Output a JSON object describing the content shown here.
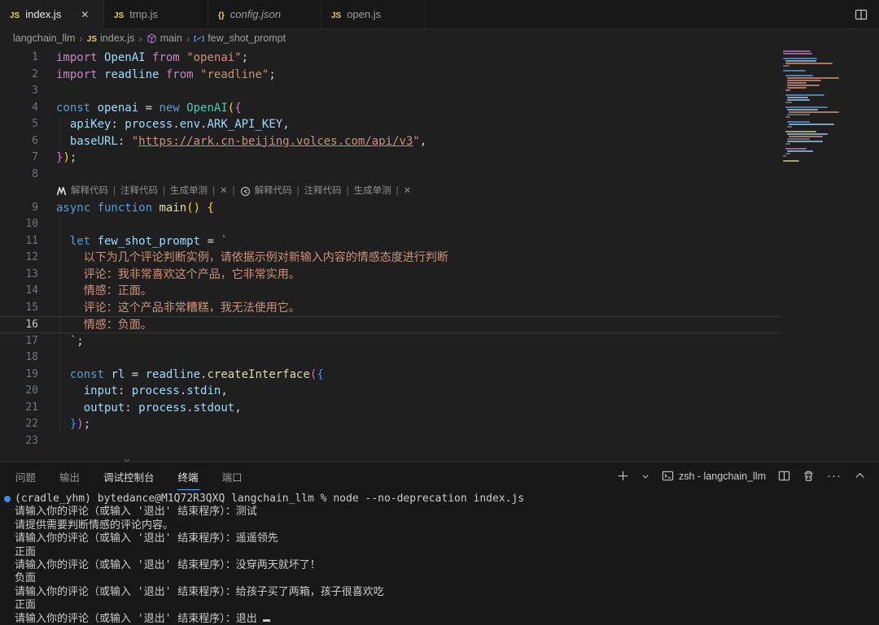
{
  "colors": {
    "accent": "#4daafc",
    "terminal_badge": "#3b8eea",
    "js_icon": "#e8d44d",
    "token": {
      "pk": "#c586c0",
      "bk": "#569cd6",
      "id": "#9cdcfe",
      "cls": "#4ec9b0",
      "fn": "#dcdcaa",
      "str": "#ce9178",
      "b1": "#ffd700",
      "b2": "#da70d6",
      "b3": "#179fff"
    }
  },
  "tabbar": {
    "tabs": [
      {
        "label": "index.js",
        "icon": "js",
        "active": true,
        "closable": true
      },
      {
        "label": "tmp.js",
        "icon": "js"
      },
      {
        "label": "config.json",
        "icon": "braces",
        "preview": true
      },
      {
        "label": "open.js",
        "icon": "js"
      }
    ],
    "actions": [
      {
        "name": "split-editor",
        "icon": "split"
      }
    ]
  },
  "breadcrumb": {
    "items": [
      {
        "label": "langchain_llm"
      },
      {
        "label": "index.js",
        "icon": "js"
      },
      {
        "label": "main",
        "icon": "cube"
      },
      {
        "label": "few_shot_prompt",
        "icon": "variable"
      }
    ]
  },
  "editor": {
    "codelens": {
      "after_line": 8,
      "groups": [
        {
          "icon": "marscode",
          "items": [
            "解释代码",
            "注释代码",
            "生成单测",
            "✕"
          ]
        },
        {
          "icon": "ai-circle",
          "items": [
            "解释代码",
            "注释代码",
            "生成单测",
            "✕"
          ]
        }
      ]
    },
    "current_line": 16,
    "lines": [
      {
        "n": 1,
        "segs": [
          [
            "pk",
            "import "
          ],
          [
            "id",
            "OpenAI"
          ],
          [
            "pk",
            " from "
          ],
          [
            "str",
            "\"openai\""
          ],
          [
            "pn",
            ";"
          ]
        ]
      },
      {
        "n": 2,
        "segs": [
          [
            "pk",
            "import "
          ],
          [
            "id",
            "readline"
          ],
          [
            "pk",
            " from "
          ],
          [
            "str",
            "\"readline\""
          ],
          [
            "pn",
            ";"
          ]
        ]
      },
      {
        "n": 3,
        "segs": []
      },
      {
        "n": 4,
        "segs": [
          [
            "bk",
            "const "
          ],
          [
            "id",
            "openai"
          ],
          [
            "pn",
            " = "
          ],
          [
            "bk",
            "new "
          ],
          [
            "cls",
            "OpenAI"
          ],
          [
            "b1",
            "("
          ],
          [
            "b2",
            "{"
          ]
        ]
      },
      {
        "n": 5,
        "guide": true,
        "segs": [
          [
            "pn",
            "  "
          ],
          [
            "id",
            "apiKey"
          ],
          [
            "pn",
            ": "
          ],
          [
            "id",
            "process"
          ],
          [
            "pn",
            "."
          ],
          [
            "id",
            "env"
          ],
          [
            "pn",
            "."
          ],
          [
            "id",
            "ARK_API_KEY"
          ],
          [
            "pn",
            ","
          ]
        ]
      },
      {
        "n": 6,
        "guide": true,
        "segs": [
          [
            "pn",
            "  "
          ],
          [
            "id",
            "baseURL"
          ],
          [
            "pn",
            ": "
          ],
          [
            "str",
            "\""
          ],
          [
            "lnk",
            "https://ark.cn-beijing.volces.com/api/v3"
          ],
          [
            "str",
            "\""
          ],
          [
            "pn",
            ","
          ]
        ]
      },
      {
        "n": 7,
        "segs": [
          [
            "b2",
            "}"
          ],
          [
            "b1",
            ")"
          ],
          [
            "pn",
            ";"
          ]
        ]
      },
      {
        "n": 8,
        "segs": []
      },
      {
        "n": 9,
        "segs": [
          [
            "bk",
            "async "
          ],
          [
            "bk",
            "function "
          ],
          [
            "fn",
            "main"
          ],
          [
            "b1",
            "()"
          ],
          [
            "pn",
            " "
          ],
          [
            "b1",
            "{"
          ]
        ]
      },
      {
        "n": 10,
        "guide": true,
        "segs": []
      },
      {
        "n": 11,
        "guide": true,
        "segs": [
          [
            "pn",
            "  "
          ],
          [
            "bk",
            "let "
          ],
          [
            "id",
            "few_shot_prompt"
          ],
          [
            "pn",
            " = "
          ],
          [
            "str",
            "`"
          ]
        ]
      },
      {
        "n": 12,
        "guide": true,
        "segs": [
          [
            "str",
            "    以下为几个评论判断实例，请依据示例对新输入内容的情感态度进行判断"
          ]
        ]
      },
      {
        "n": 13,
        "guide": true,
        "segs": [
          [
            "str",
            "    评论：我非常喜欢这个产品，它非常实用。"
          ]
        ]
      },
      {
        "n": 14,
        "guide": true,
        "segs": [
          [
            "str",
            "    情感：正面。"
          ]
        ]
      },
      {
        "n": 15,
        "guide": true,
        "segs": [
          [
            "str",
            "    评论：这个产品非常糟糕，我无法使用它。"
          ]
        ]
      },
      {
        "n": 16,
        "guide": true,
        "segs": [
          [
            "str",
            "    情感：负面。"
          ]
        ]
      },
      {
        "n": 17,
        "guide": true,
        "segs": [
          [
            "str",
            "  `"
          ],
          [
            "pn",
            ";"
          ]
        ]
      },
      {
        "n": 18,
        "guide": true,
        "segs": []
      },
      {
        "n": 19,
        "guide": true,
        "segs": [
          [
            "pn",
            "  "
          ],
          [
            "bk",
            "const "
          ],
          [
            "id",
            "rl"
          ],
          [
            "pn",
            " = "
          ],
          [
            "id",
            "readline"
          ],
          [
            "pn",
            "."
          ],
          [
            "fn",
            "createInterface"
          ],
          [
            "b2",
            "("
          ],
          [
            "b3",
            "{"
          ]
        ]
      },
      {
        "n": 20,
        "guide": true,
        "segs": [
          [
            "pn",
            "    "
          ],
          [
            "id",
            "input"
          ],
          [
            "pn",
            ": "
          ],
          [
            "id",
            "process"
          ],
          [
            "pn",
            "."
          ],
          [
            "id",
            "stdin"
          ],
          [
            "pn",
            ","
          ]
        ]
      },
      {
        "n": 21,
        "guide": true,
        "segs": [
          [
            "pn",
            "    "
          ],
          [
            "id",
            "output"
          ],
          [
            "pn",
            ": "
          ],
          [
            "id",
            "process"
          ],
          [
            "pn",
            "."
          ],
          [
            "id",
            "stdout"
          ],
          [
            "pn",
            ","
          ]
        ]
      },
      {
        "n": 22,
        "guide": true,
        "segs": [
          [
            "pn",
            "  "
          ],
          [
            "b3",
            "}"
          ],
          [
            "b2",
            ")"
          ],
          [
            "pn",
            ";"
          ]
        ]
      },
      {
        "n": 23,
        "segs": []
      }
    ],
    "overflow_hint": "⌄"
  },
  "minimap": {
    "rows": [
      [
        0,
        34,
        "p"
      ],
      [
        0,
        36,
        "p"
      ],
      [
        0,
        0,
        "n"
      ],
      [
        0,
        42,
        "b"
      ],
      [
        3,
        38,
        "i"
      ],
      [
        3,
        58,
        "o"
      ],
      [
        0,
        8,
        "g"
      ],
      [
        0,
        0,
        "n"
      ],
      [
        0,
        28,
        "b"
      ],
      [
        0,
        0,
        "n"
      ],
      [
        3,
        34,
        "b"
      ],
      [
        5,
        64,
        "o"
      ],
      [
        5,
        42,
        "o"
      ],
      [
        5,
        24,
        "o"
      ],
      [
        5,
        40,
        "o"
      ],
      [
        5,
        24,
        "o"
      ],
      [
        3,
        6,
        "o"
      ],
      [
        0,
        0,
        "n"
      ],
      [
        3,
        48,
        "b"
      ],
      [
        5,
        26,
        "i"
      ],
      [
        5,
        28,
        "i"
      ],
      [
        3,
        8,
        "g"
      ],
      [
        0,
        0,
        "n"
      ],
      [
        3,
        52,
        "b"
      ],
      [
        5,
        38,
        "i"
      ],
      [
        7,
        62,
        "o"
      ],
      [
        5,
        28,
        "g"
      ],
      [
        3,
        6,
        "g"
      ],
      [
        0,
        0,
        "n"
      ],
      [
        5,
        28,
        "b"
      ],
      [
        7,
        56,
        "i"
      ],
      [
        5,
        6,
        "g"
      ],
      [
        0,
        0,
        "n"
      ],
      [
        3,
        38,
        "y"
      ],
      [
        5,
        50,
        "i"
      ],
      [
        7,
        42,
        "o"
      ],
      [
        5,
        28,
        "g"
      ],
      [
        5,
        44,
        "i"
      ],
      [
        3,
        6,
        "g"
      ],
      [
        0,
        0,
        "n"
      ],
      [
        3,
        26,
        "p"
      ],
      [
        5,
        32,
        "i"
      ],
      [
        3,
        6,
        "g"
      ],
      [
        0,
        4,
        "g"
      ],
      [
        0,
        0,
        "n"
      ],
      [
        0,
        20,
        "y"
      ]
    ],
    "palette": {
      "p": "#9a5ca3",
      "b": "#4d7da8",
      "i": "#7fa3bd",
      "o": "#a8796a",
      "y": "#a8a06a",
      "g": "#6a6a6a",
      "n": "transparent"
    }
  },
  "panel": {
    "tabs": [
      {
        "label": "问题"
      },
      {
        "label": "输出"
      },
      {
        "label": "调试控制台",
        "bright": true
      },
      {
        "label": "终端",
        "active": true
      },
      {
        "label": "端口"
      }
    ],
    "terminal_label": "zsh - langchain_llm",
    "actions_left": [
      {
        "name": "new-terminal",
        "icon": "plus"
      },
      {
        "name": "launch-profile",
        "icon": "chevron-down"
      }
    ],
    "actions_right": [
      {
        "name": "split-terminal",
        "icon": "split"
      },
      {
        "name": "kill-terminal",
        "icon": "trash"
      },
      {
        "name": "more-actions",
        "icon": "ellipsis"
      },
      {
        "name": "maximize-panel",
        "icon": "chevron-up"
      }
    ]
  },
  "terminal": {
    "lines": [
      {
        "text": "(cradle_yhm) bytedance@M1Q72R3QXQ langchain_llm % node --no-deprecation index.js",
        "badge": true
      },
      {
        "text": "请输入你的评论（或输入 '退出' 结束程序）：测试"
      },
      {
        "text": "请提供需要判断情感的评论内容。"
      },
      {
        "text": "请输入你的评论（或输入 '退出' 结束程序）：遥遥领先"
      },
      {
        "text": "正面"
      },
      {
        "text": "请输入你的评论（或输入 '退出' 结束程序）：没穿两天就坏了！"
      },
      {
        "text": "负面"
      },
      {
        "text": "请输入你的评论（或输入 '退出' 结束程序）：给孩子买了两箱，孩子很喜欢吃"
      },
      {
        "text": "正面"
      },
      {
        "text": "请输入你的评论（或输入 '退出' 结束程序）：退出",
        "cursor": true
      }
    ]
  }
}
